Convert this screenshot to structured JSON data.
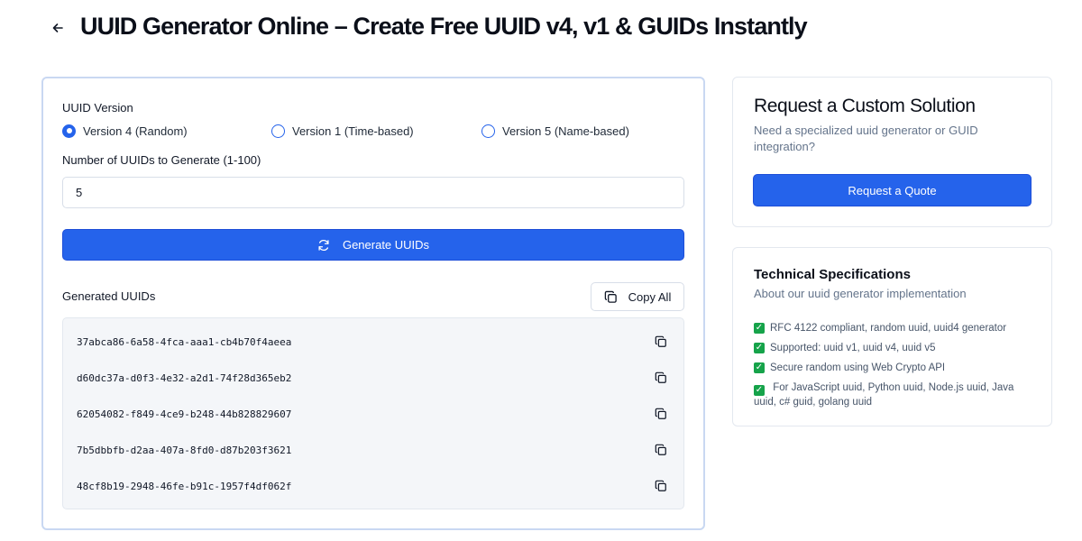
{
  "header": {
    "title": "UUID Generator Online – Create Free UUID v4, v1 & GUIDs Instantly"
  },
  "generator": {
    "version_label": "UUID Version",
    "versions": [
      {
        "label": "Version 4 (Random)",
        "selected": true
      },
      {
        "label": "Version 1 (Time-based)",
        "selected": false
      },
      {
        "label": "Version 5 (Name-based)",
        "selected": false
      }
    ],
    "count_label": "Number of UUIDs to Generate (1-100)",
    "count_value": "5",
    "generate_label": "Generate UUIDs",
    "results_label": "Generated UUIDs",
    "copy_all_label": "Copy All",
    "uuids": [
      "37abca86-6a58-4fca-aaa1-cb4b70f4aeea",
      "d60dc37a-d0f3-4e32-a2d1-74f28d365eb2",
      "62054082-f849-4ce9-b248-44b828829607",
      "7b5dbbfb-d2aa-407a-8fd0-d87b203f3621",
      "48cf8b19-2948-46fe-b91c-1957f4df062f"
    ]
  },
  "quote_card": {
    "title": "Request a Custom Solution",
    "description": "Need a specialized uuid generator or GUID integration?",
    "button_label": "Request a Quote"
  },
  "specs_card": {
    "title": "Technical Specifications",
    "subtitle": "About our uuid generator implementation",
    "items": [
      "RFC 4122 compliant, random uuid, uuid4 generator",
      "Supported: uuid v1, uuid v4, uuid v5",
      "Secure random using Web Crypto API",
      "For JavaScript uuid, Python uuid, Node.js uuid, Java uuid, c# guid, golang uuid"
    ]
  },
  "colors": {
    "accent": "#2563eb",
    "card_border": "#c9d8f2",
    "check": "#16a34a"
  }
}
